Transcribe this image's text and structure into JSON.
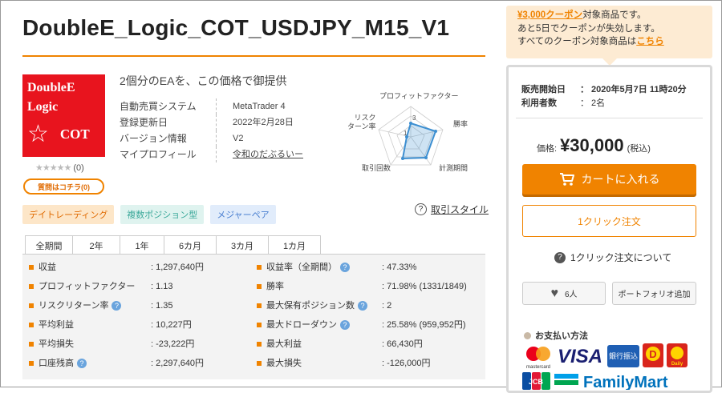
{
  "product": {
    "title": "DoubleE_Logic_COT_USDJPY_M15_V1",
    "lead": "2個分のEAを、この価格で御提供",
    "logo": {
      "line1": "DoubleE",
      "line2": "Logic",
      "star": "☆",
      "line3": "COT"
    },
    "rating": {
      "stars": "★★★★★",
      "count": "(0)"
    },
    "question_button": "質問はコチラ(0)",
    "info": [
      {
        "key": "自動売買システム",
        "value": "MetaTrader 4"
      },
      {
        "key": "登録更新日",
        "value": "2022年2月28日"
      },
      {
        "key": "バージョン情報",
        "value": "V2"
      },
      {
        "key": "マイプロフィール",
        "value": "令和のだぶるいー"
      }
    ],
    "radar": {
      "labels": {
        "profit_factor": "プロフィットファクター",
        "risk_return": "リスク\nターン率",
        "win_rate": "勝率",
        "trades": "取引回数",
        "period": "計測期間"
      },
      "center_value": "3",
      "center_value2": "1"
    },
    "tags": [
      "デイトレーディング",
      "複数ポジション型",
      "メジャーペア"
    ],
    "trade_style_link": "取引スタイル"
  },
  "tabs": [
    "全期間",
    "2年",
    "1年",
    "6カ月",
    "3カ月",
    "1カ月"
  ],
  "stats_left": [
    {
      "key": "収益",
      "value": ": 1,297,640円",
      "hint": false
    },
    {
      "key": "プロフィットファクター",
      "value": ": 1.13",
      "hint": false
    },
    {
      "key": "リスクリターン率",
      "value": ": 1.35",
      "hint": true
    },
    {
      "key": "平均利益",
      "value": ": 10,227円",
      "hint": false
    },
    {
      "key": "平均損失",
      "value": ": -23,222円",
      "hint": false
    },
    {
      "key": "口座残高",
      "value": ": 2,297,640円",
      "hint": true
    }
  ],
  "stats_right": [
    {
      "key": "収益率（全期間）",
      "value": ": 47.33%",
      "hint": true
    },
    {
      "key": "勝率",
      "value": ": 71.98% (1331/1849)",
      "hint": false
    },
    {
      "key": "最大保有ポジション数",
      "value": ": 2",
      "hint": true
    },
    {
      "key": "最大ドローダウン",
      "value": ": 25.58% (959,952円)",
      "hint": true
    },
    {
      "key": "最大利益",
      "value": ": 66,430円",
      "hint": false
    },
    {
      "key": "最大損失",
      "value": ": -126,000円",
      "hint": false
    }
  ],
  "hint_glyph": "?",
  "coupon": {
    "highlight": "¥3,000クーポン",
    "line1_rest": "対象商品です。",
    "line2": "あと5日でクーポンが失効します。",
    "line3_pre": "すべてのクーポン対象商品は",
    "line3_link": "こちら"
  },
  "sales": {
    "start_label": "販売開始日",
    "start_value": "： 2020年5月7日 11時20分",
    "users_label": "利用者数",
    "users_value": "： 2名"
  },
  "price": {
    "label": "価格:",
    "value": "¥30,000",
    "tax": "(税込)"
  },
  "cart_button": "カートに入れる",
  "oneclick_button": "1クリック注文",
  "oneclick_about": "1クリック注文について",
  "favorite": {
    "count": "6人"
  },
  "portfolio_button": "ポートフォリオ追加",
  "payment": {
    "title": "お支払い方法",
    "methods": [
      "mastercard",
      "VISA",
      "銀行振込",
      "D",
      "Daily",
      "JCB",
      "FamilyMart"
    ]
  },
  "colors": {
    "accent": "#f08300",
    "logo_red": "#e8141e",
    "radar_blue": "#3d8fd1"
  }
}
